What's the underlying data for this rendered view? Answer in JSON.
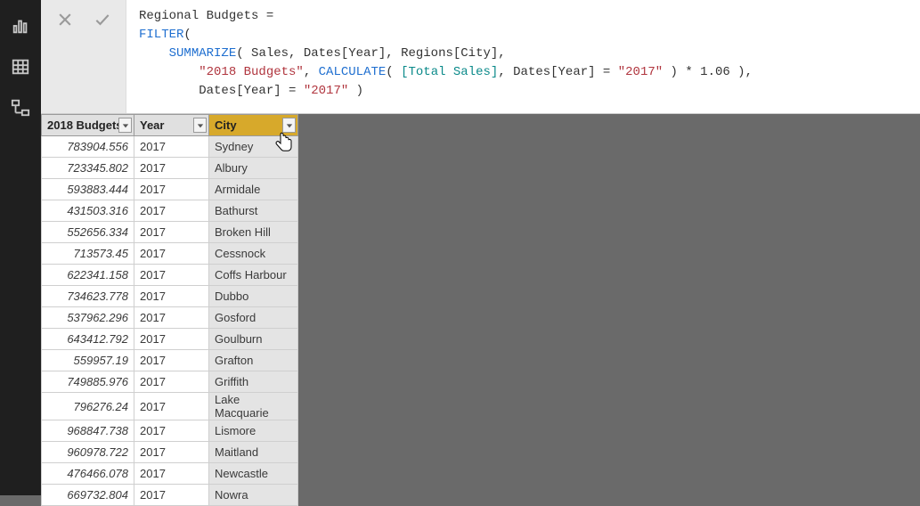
{
  "nav": {
    "icons": [
      "report-icon",
      "data-icon",
      "model-icon"
    ]
  },
  "formula": {
    "line1_name": "Regional Budgets =",
    "line2_kw": "FILTER",
    "line2_rest": "(",
    "line3_kw": "SUMMARIZE",
    "line3_args": "( Sales, Dates[Year], Regions[City],",
    "line4_indent": "        ",
    "line4_str1": "\"2018 Budgets\"",
    "line4_comma1": ", ",
    "line4_kw": "CALCULATE",
    "line4_p1": "( ",
    "line4_measure": "[Total Sales]",
    "line4_args2": ", Dates[Year] = ",
    "line4_str2": "\"2017\"",
    "line4_tail": " ) * 1.06 ),",
    "line5_indent": "        ",
    "line5_text": "Dates[Year] = ",
    "line5_str": "\"2017\"",
    "line5_tail": " )"
  },
  "columns": {
    "budget": "2018 Budgets",
    "year": "Year",
    "city": "City"
  },
  "rows": [
    {
      "budget": "783904.556",
      "year": "2017",
      "city": "Sydney"
    },
    {
      "budget": "723345.802",
      "year": "2017",
      "city": "Albury"
    },
    {
      "budget": "593883.444",
      "year": "2017",
      "city": "Armidale"
    },
    {
      "budget": "431503.316",
      "year": "2017",
      "city": "Bathurst"
    },
    {
      "budget": "552656.334",
      "year": "2017",
      "city": "Broken Hill"
    },
    {
      "budget": "713573.45",
      "year": "2017",
      "city": "Cessnock"
    },
    {
      "budget": "622341.158",
      "year": "2017",
      "city": "Coffs Harbour"
    },
    {
      "budget": "734623.778",
      "year": "2017",
      "city": "Dubbo"
    },
    {
      "budget": "537962.296",
      "year": "2017",
      "city": "Gosford"
    },
    {
      "budget": "643412.792",
      "year": "2017",
      "city": "Goulburn"
    },
    {
      "budget": "559957.19",
      "year": "2017",
      "city": "Grafton"
    },
    {
      "budget": "749885.976",
      "year": "2017",
      "city": "Griffith"
    },
    {
      "budget": "796276.24",
      "year": "2017",
      "city": "Lake Macquarie"
    },
    {
      "budget": "968847.738",
      "year": "2017",
      "city": "Lismore"
    },
    {
      "budget": "960978.722",
      "year": "2017",
      "city": "Maitland"
    },
    {
      "budget": "476466.078",
      "year": "2017",
      "city": "Newcastle"
    },
    {
      "budget": "669732.804",
      "year": "2017",
      "city": "Nowra"
    }
  ]
}
